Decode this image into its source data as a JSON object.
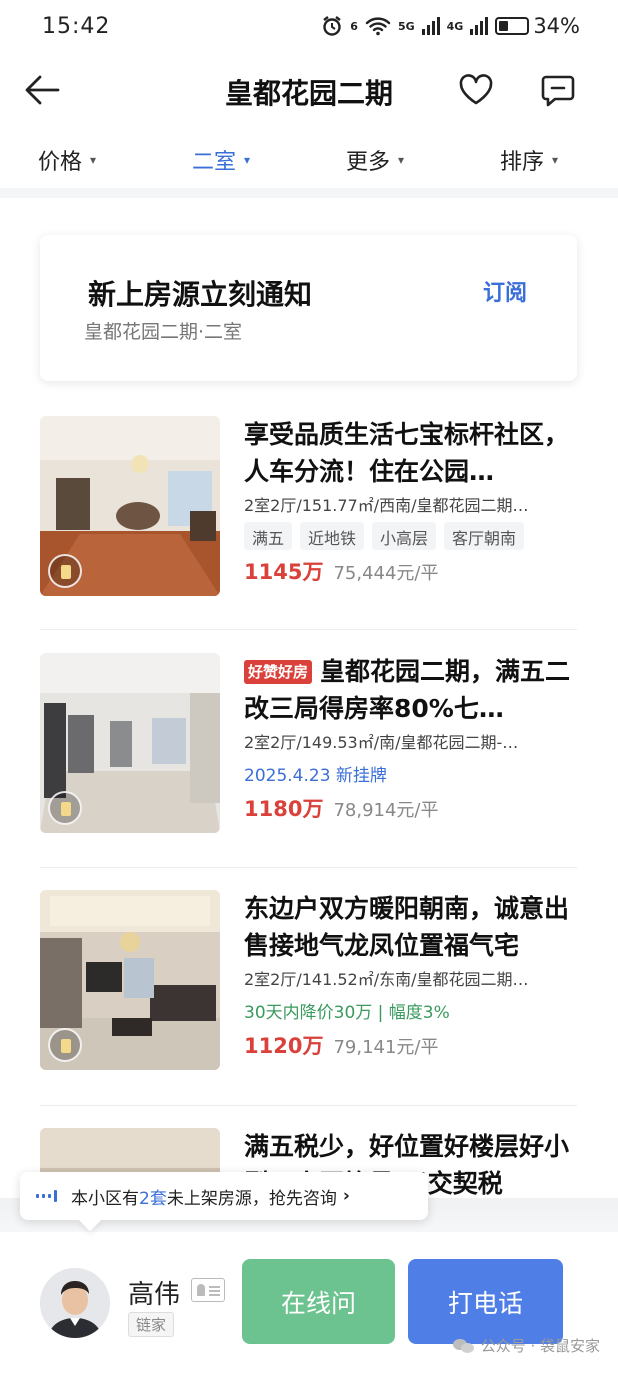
{
  "status_bar": {
    "time": "15:42",
    "net1": "6",
    "net2": "5G",
    "net3": "4G",
    "battery": "34%"
  },
  "nav": {
    "title": "皇都花园二期"
  },
  "filters": [
    {
      "label": "价格"
    },
    {
      "label": "二室"
    },
    {
      "label": "更多"
    },
    {
      "label": "排序"
    }
  ],
  "subscribe": {
    "title": "新上房源立刻通知",
    "subtitle": "皇都花园二期·二室",
    "button": "订阅"
  },
  "listings": [
    {
      "title": "享受品质生活七宝标杆社区，人车分流！住在公园…",
      "meta": "2室2厅/151.77㎡/西南/皇都花园二期…",
      "tags": [
        "满五",
        "近地铁",
        "小高层",
        "客厅朝南"
      ],
      "price": "1145万",
      "unit_price": "75,444元/平"
    },
    {
      "badge": "好赞好房",
      "title": "皇都花园二期，满五二改三局得房率80%七…",
      "meta": "2室2厅/149.53㎡/南/皇都花园二期-…",
      "note": "2025.4.23 新挂牌",
      "price": "1180万",
      "unit_price": "78,914元/平"
    },
    {
      "title": "东边户双方暖阳朝南，诚意出售接地气龙凤位置福气宅",
      "meta": "2室2厅/141.52㎡/东南/皇都花园二期…",
      "note": "30天内降价30万 | 幅度3%",
      "price": "1120万",
      "unit_price": "79,141元/平"
    },
    {
      "title": "满五税少，好位置好楼层好小型，小区均号 只交契税"
    }
  ],
  "tip": {
    "prefix": "本小区有",
    "count": "2套",
    "suffix": "未上架房源，抢先咨询"
  },
  "agent": {
    "name": "高伟",
    "brand": "链家"
  },
  "actions": {
    "chat": "在线问",
    "call": "打电话"
  },
  "watermark": "公众号 · 袋鼠安家",
  "colors": {
    "accent": "#3b6fd8",
    "price": "#d9413a",
    "chat": "#6cc38f",
    "call": "#4f7fe6",
    "drop_note": "#3a9a5e"
  }
}
